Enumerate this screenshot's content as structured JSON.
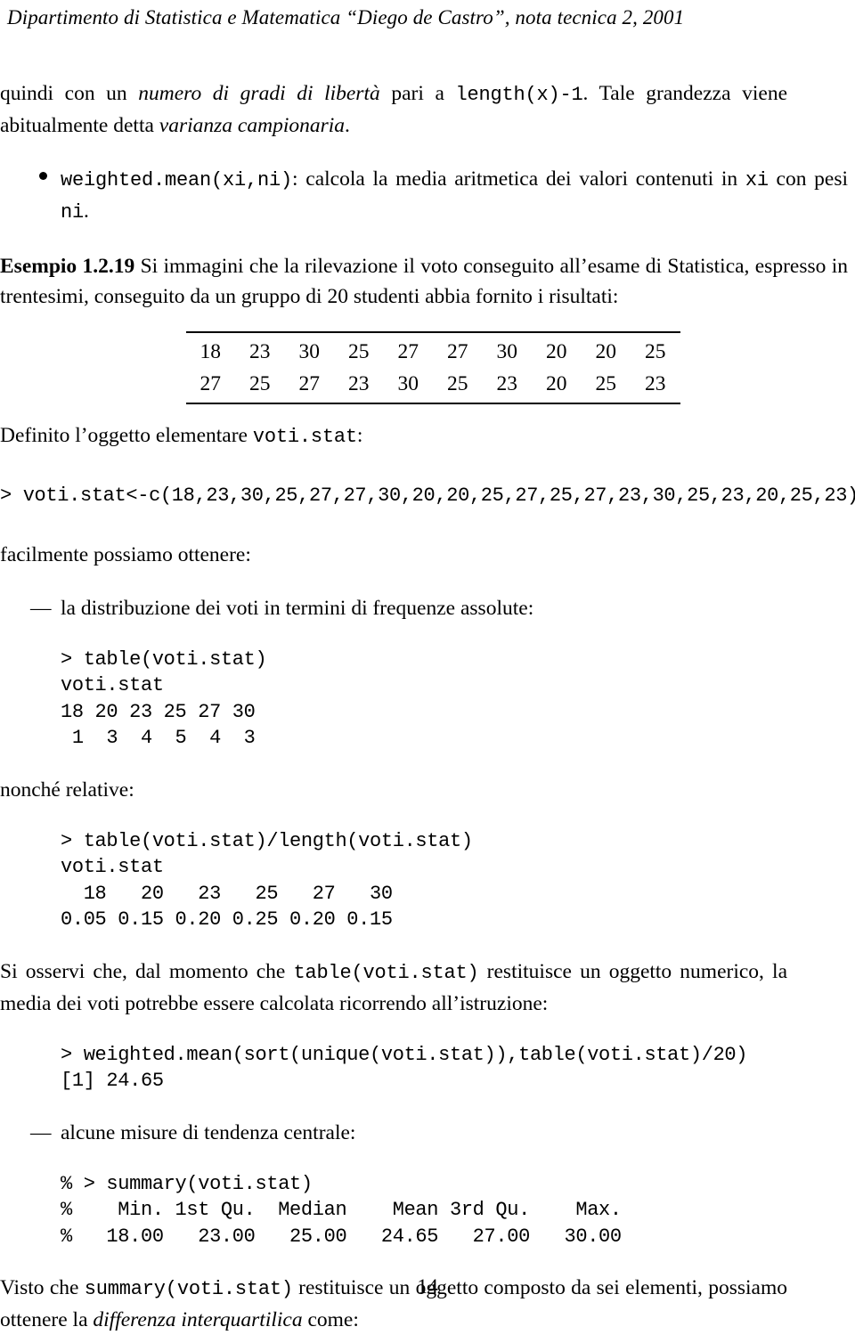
{
  "header": {
    "running_head": "Dipartimento di Statistica e Matematica “Diego de Castro”, nota tecnica 2, 2001"
  },
  "paragraphs": {
    "p_quindi_a": "quindi con un ",
    "p_quindi_italic": "numero di gradi di libertà",
    "p_quindi_b": " pari a ",
    "p_quindi_code": "length(x)-1",
    "p_quindi_c": ". Tale grandezza viene abitualmente detta ",
    "p_quindi_italic2": "varianza campionaria",
    "p_quindi_d": ".",
    "bullet_code": "weighted.mean(xi,ni)",
    "bullet_text_a": ": calcola la media aritmetica dei valori contenuti in ",
    "bullet_code2": "xi",
    "bullet_text_b": " con pesi ",
    "bullet_code3": "ni",
    "bullet_text_c": ".",
    "esempio_label": "Esempio 1.2.19",
    "esempio_text": " Si immagini che la rilevazione il voto conseguito all’esame di Statistica, espresso in trentesimi, conseguito da un gruppo di 20 studenti abbia fornito i risultati:",
    "definito_a": "Definito l’oggetto elementare ",
    "definito_code": "voti.stat",
    "definito_b": ":",
    "facilmente": "facilmente possiamo ottenere:",
    "dash_assolute": "la distribuzione dei voti in termini di frequenze assolute:",
    "nonche": "nonché relative:",
    "siosservi_a": "Si osservi che, dal momento che ",
    "siosservi_code": "table(voti.stat)",
    "siosservi_b": " restituisce un oggetto numerico, la media dei voti potrebbe essere calcolata ricorrendo all’istruzione:",
    "dash_tendenza": "alcune misure di tendenza centrale:",
    "visto_a": "Visto che ",
    "visto_code": "summary(voti.stat)",
    "visto_b": " restituisce un oggetto composto da sei elementi, possiamo ottenere la ",
    "visto_italic": "differenza interquartilica",
    "visto_c": " come:"
  },
  "data_table": {
    "row1": [
      "18",
      "23",
      "30",
      "25",
      "27",
      "27",
      "30",
      "20",
      "20",
      "25"
    ],
    "row2": [
      "27",
      "25",
      "27",
      "23",
      "30",
      "25",
      "23",
      "20",
      "25",
      "23"
    ]
  },
  "code_blocks": {
    "assign": "> voti.stat<-c(18,23,30,25,27,27,30,20,20,25,27,25,27,23,30,25,23,20,25,23)",
    "table_abs": "> table(voti.stat)\nvoti.stat\n18 20 23 25 27 30\n 1  3  4  5  4  3",
    "table_rel": "> table(voti.stat)/length(voti.stat)\nvoti.stat\n  18   20   23   25   27   30\n0.05 0.15 0.20 0.25 0.20 0.15",
    "weighted_mean": "> weighted.mean(sort(unique(voti.stat)),table(voti.stat)/20)\n[1] 24.65",
    "summary": "% > summary(voti.stat)\n%    Min. 1st Qu.  Median    Mean 3rd Qu.    Max.\n%   18.00   23.00   25.00   24.65   27.00   30.00"
  },
  "stats": {
    "frequency_values": [
      "18",
      "20",
      "23",
      "25",
      "27",
      "30"
    ],
    "frequency_counts": [
      "1",
      "3",
      "4",
      "5",
      "4",
      "3"
    ],
    "relative_frequencies": [
      "0.05",
      "0.15",
      "0.20",
      "0.25",
      "0.20",
      "0.15"
    ],
    "weighted_mean_result": "24.65",
    "summary_labels": [
      "Min.",
      "1st Qu.",
      "Median",
      "Mean",
      "3rd Qu.",
      "Max."
    ],
    "summary_values": [
      "18.00",
      "23.00",
      "25.00",
      "24.65",
      "27.00",
      "30.00"
    ]
  },
  "footer": {
    "page_number": "14"
  }
}
